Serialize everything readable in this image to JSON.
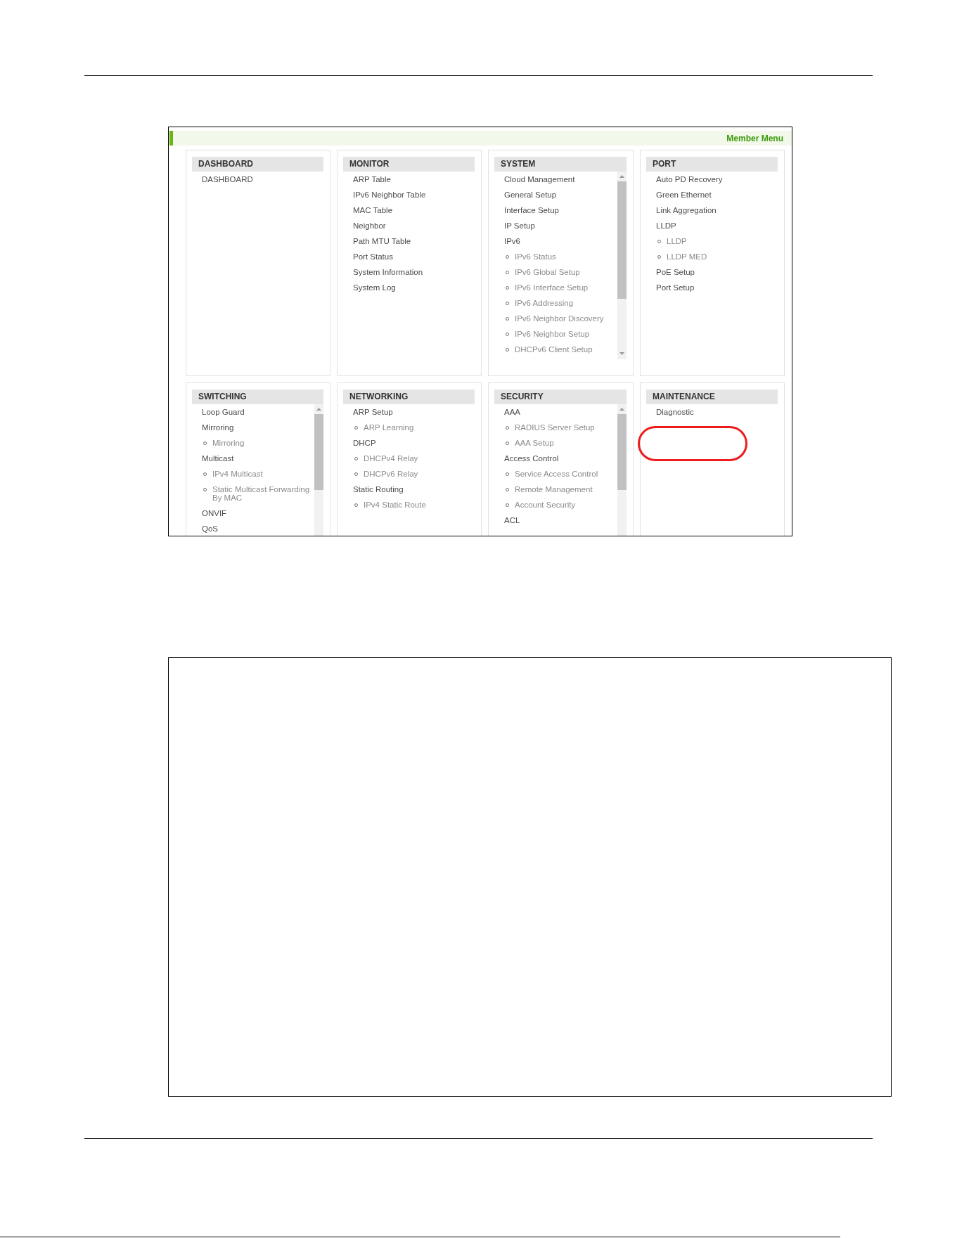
{
  "header_bar": {
    "title": "Member Menu"
  },
  "sections": [
    {
      "title": "DASHBOARD",
      "scrollable": false,
      "highlighted": false,
      "items": [
        {
          "label": "DASHBOARD"
        }
      ]
    },
    {
      "title": "MONITOR",
      "scrollable": false,
      "highlighted": false,
      "items": [
        {
          "label": "ARP Table"
        },
        {
          "label": "IPv6 Neighbor Table"
        },
        {
          "label": "MAC Table"
        },
        {
          "label": "Neighbor"
        },
        {
          "label": "Path MTU Table"
        },
        {
          "label": "Port Status"
        },
        {
          "label": "System Information"
        },
        {
          "label": "System Log"
        }
      ]
    },
    {
      "title": "SYSTEM",
      "scrollable": true,
      "highlighted": false,
      "items": [
        {
          "label": "Cloud Management"
        },
        {
          "label": "General Setup"
        },
        {
          "label": "Interface Setup"
        },
        {
          "label": "IP Setup"
        },
        {
          "label": "IPv6",
          "children": [
            {
              "label": "IPv6 Status"
            },
            {
              "label": "IPv6 Global Setup"
            },
            {
              "label": "IPv6 Interface Setup"
            },
            {
              "label": "IPv6 Addressing"
            },
            {
              "label": "IPv6 Neighbor Discovery"
            },
            {
              "label": "IPv6 Neighbor Setup"
            },
            {
              "label": "DHCPv6 Client Setup"
            }
          ]
        }
      ]
    },
    {
      "title": "PORT",
      "scrollable": false,
      "highlighted": false,
      "items": [
        {
          "label": "Auto PD Recovery"
        },
        {
          "label": "Green Ethernet"
        },
        {
          "label": "Link Aggregation"
        },
        {
          "label": "LLDP",
          "children": [
            {
              "label": "LLDP"
            },
            {
              "label": "LLDP MED"
            }
          ]
        },
        {
          "label": "PoE Setup"
        },
        {
          "label": "Port Setup"
        }
      ]
    },
    {
      "title": "SWITCHING",
      "scrollable": true,
      "highlighted": false,
      "items": [
        {
          "label": "Loop Guard"
        },
        {
          "label": "Mirroring",
          "children": [
            {
              "label": "Mirroring"
            }
          ]
        },
        {
          "label": "Multicast",
          "children": [
            {
              "label": "IPv4 Multicast"
            },
            {
              "label": "Static Multicast Forwarding By MAC"
            }
          ]
        },
        {
          "label": "ONVIF"
        },
        {
          "label": "QoS"
        }
      ]
    },
    {
      "title": "NETWORKING",
      "scrollable": false,
      "highlighted": false,
      "items": [
        {
          "label": "ARP Setup",
          "children": [
            {
              "label": "ARP Learning"
            }
          ]
        },
        {
          "label": "DHCP",
          "children": [
            {
              "label": "DHCPv4 Relay"
            },
            {
              "label": "DHCPv6 Relay"
            }
          ]
        },
        {
          "label": "Static Routing",
          "children": [
            {
              "label": "IPv4 Static Route"
            }
          ]
        }
      ]
    },
    {
      "title": "SECURITY",
      "scrollable": true,
      "highlighted": false,
      "items": [
        {
          "label": "AAA",
          "children": [
            {
              "label": "RADIUS Server Setup"
            },
            {
              "label": "AAA Setup"
            }
          ]
        },
        {
          "label": "Access Control",
          "children": [
            {
              "label": "Service Access Control"
            },
            {
              "label": "Remote Management"
            },
            {
              "label": "Account Security"
            }
          ]
        },
        {
          "label": "ACL"
        }
      ]
    },
    {
      "title": "MAINTENANCE",
      "scrollable": false,
      "highlighted": true,
      "items": [
        {
          "label": "Diagnostic"
        }
      ]
    }
  ]
}
